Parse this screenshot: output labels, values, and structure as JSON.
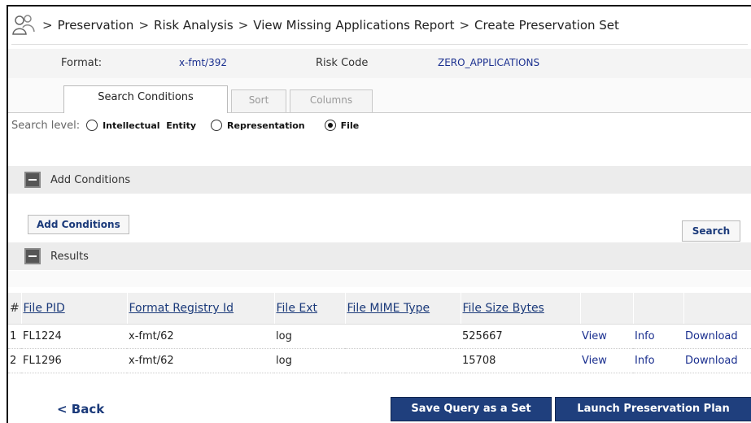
{
  "breadcrumb": {
    "icon": "users-icon",
    "items": [
      "Preservation",
      "Risk Analysis",
      "View Missing Applications Report",
      "Create Preservation Set"
    ],
    "separator": ">"
  },
  "meta": {
    "format_label": "Format:",
    "format_value": "x-fmt/392",
    "risk_label": "Risk Code",
    "risk_value": "ZERO_APPLICATIONS"
  },
  "tabs": [
    {
      "label": "Search Conditions",
      "active": true
    },
    {
      "label": "Sort",
      "active": false
    },
    {
      "label": "Columns",
      "active": false
    }
  ],
  "search_level": {
    "label": "Search level:",
    "options": [
      "Intellectual  Entity",
      "Representation",
      "File"
    ],
    "selected": "File"
  },
  "add_conditions_section": {
    "title": "Add Conditions",
    "button": "Add Conditions"
  },
  "search_button": "Search",
  "results_section": {
    "title": "Results"
  },
  "table": {
    "columns": [
      "#",
      "File PID",
      "Format Registry Id",
      "File Ext",
      "File MIME Type",
      "File Size Bytes",
      "",
      "",
      ""
    ],
    "rows": [
      {
        "num": "1",
        "pid": "FL1224",
        "format": "x-fmt/62",
        "ext": "log",
        "mime": "",
        "size": "525667",
        "view": "View",
        "info": "Info",
        "download": "Download"
      },
      {
        "num": "2",
        "pid": "FL1296",
        "format": "x-fmt/62",
        "ext": "log",
        "mime": "",
        "size": "15708",
        "view": "View",
        "info": "Info",
        "download": "Download"
      }
    ]
  },
  "footer": {
    "back": "< Back",
    "save_query": "Save Query as a Set",
    "launch_plan": "Launch Preservation Plan"
  }
}
